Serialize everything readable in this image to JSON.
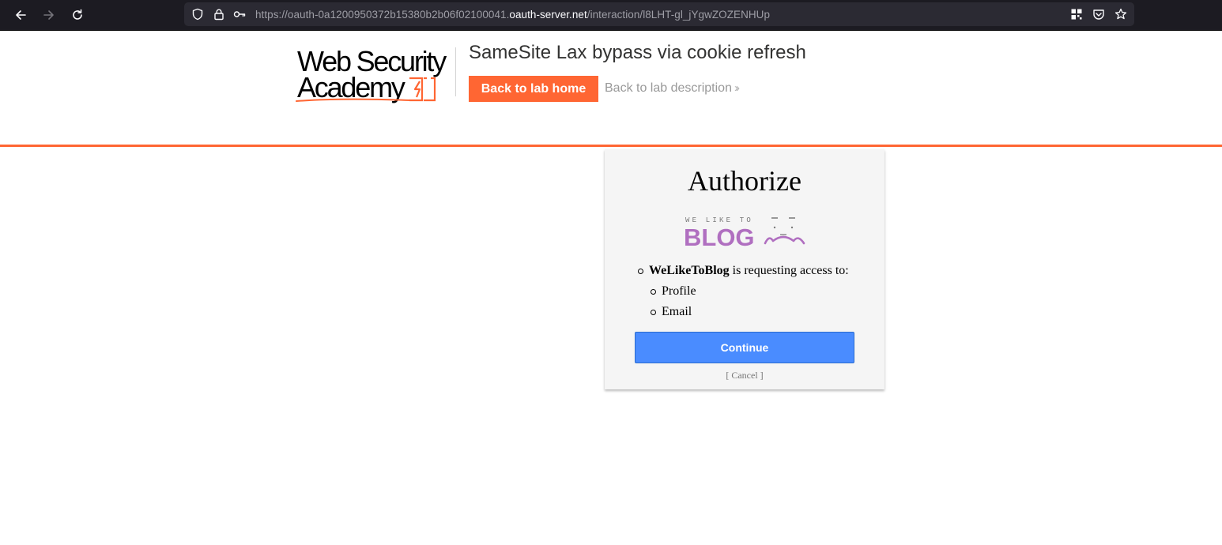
{
  "browser": {
    "url_prefix": "https://oauth-0a1200950372b15380b2b06f02100041.",
    "url_domain": "oauth-server.net",
    "url_path": "/interaction/l8LHT-gl_jYgwZOZENHUp",
    "icons": [
      "back-icon",
      "forward-icon",
      "reload-icon",
      "shield-icon",
      "lock-icon",
      "key-icon",
      "qr-code-icon",
      "pocket-icon",
      "star-icon"
    ]
  },
  "header": {
    "logo_line1": "Web Security",
    "logo_line2": "Academy",
    "lab_title": "SameSite Lax bypass via cookie refresh",
    "back_home_label": "Back to lab home",
    "back_desc_label": "Back to lab description"
  },
  "authorize": {
    "title": "Authorize",
    "blog_logo_small": "WE LIKE TO",
    "blog_logo_big": "BLOG",
    "client_name": "WeLikeToBlog",
    "request_text": " is requesting access to:",
    "scopes": [
      "Profile",
      "Email"
    ],
    "continue_label": "Continue",
    "cancel_label": "[ Cancel ]"
  },
  "colors": {
    "accent": "#ff6633",
    "continue_button": "#4a8cff",
    "blog_purple": "#b06fc0",
    "chrome_bg": "#1c1b22"
  }
}
